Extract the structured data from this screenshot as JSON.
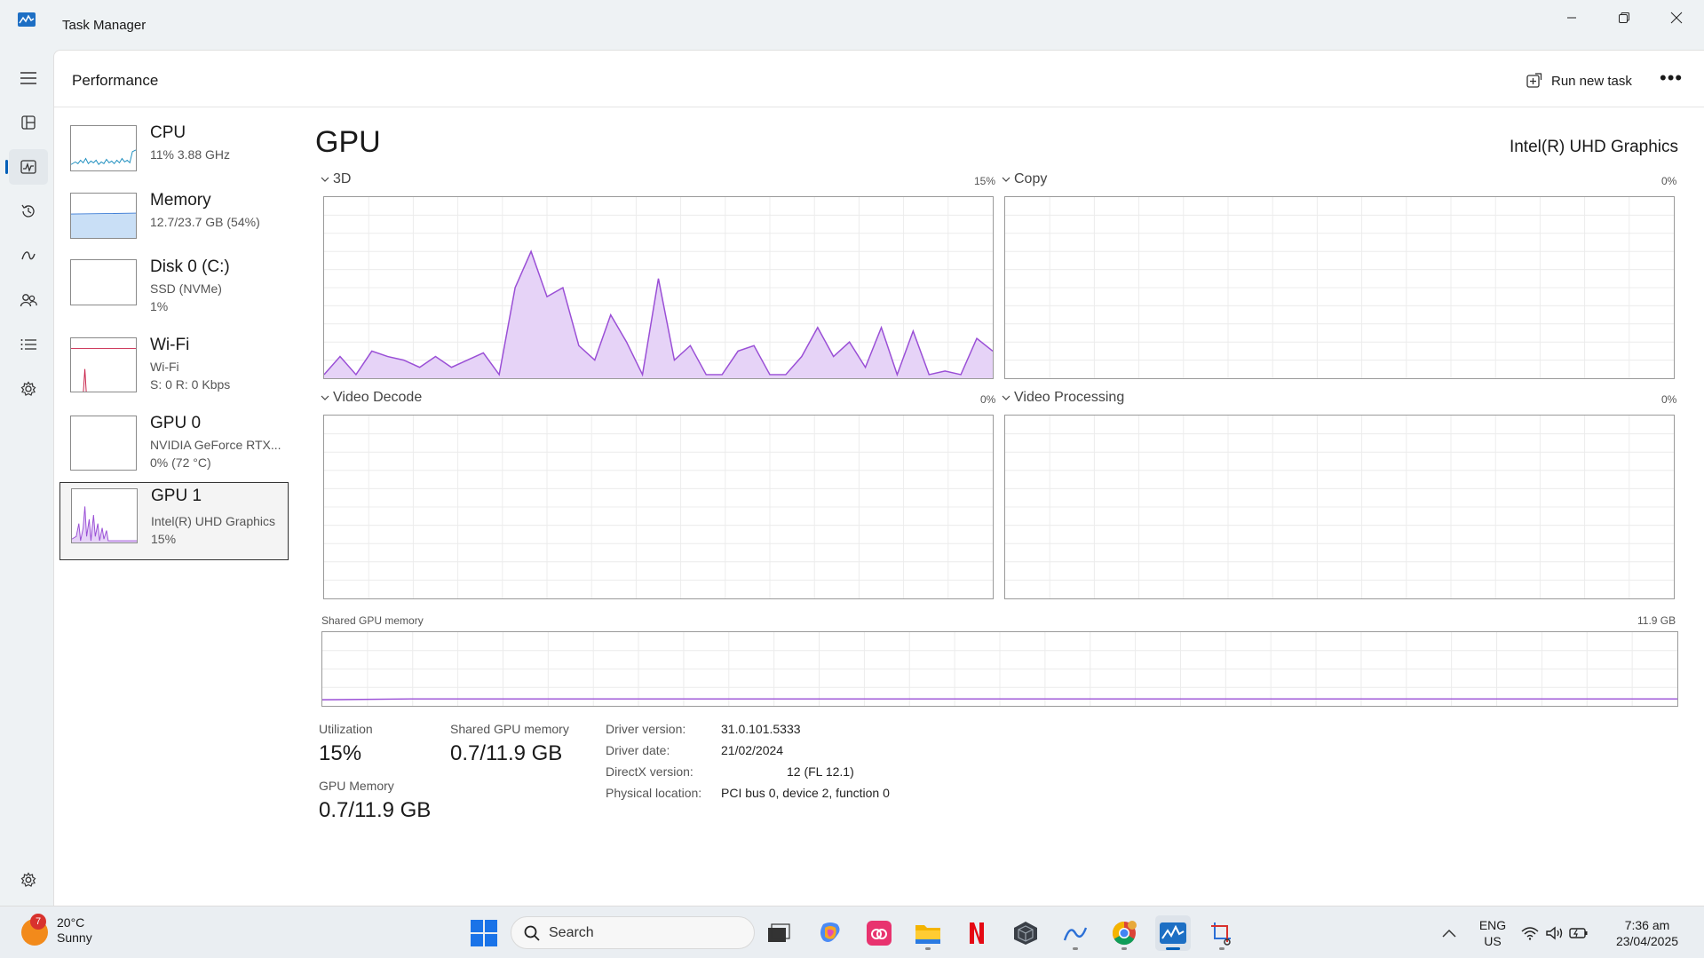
{
  "window": {
    "title": "Task Manager"
  },
  "header": {
    "page_title": "Performance",
    "run_new_task": "Run new task",
    "more": "•••"
  },
  "resources": [
    {
      "name": "CPU",
      "line1": "11%  3.88 GHz",
      "line2": ""
    },
    {
      "name": "Memory",
      "line1": "12.7/23.7 GB (54%)",
      "line2": ""
    },
    {
      "name": "Disk 0 (C:)",
      "line1": "SSD (NVMe)",
      "line2": "1%"
    },
    {
      "name": "Wi-Fi",
      "line1": "Wi-Fi",
      "line2": "S: 0  R: 0 Kbps"
    },
    {
      "name": "GPU 0",
      "line1": "NVIDIA GeForce RTX...",
      "line2": "0%  (72 °C)"
    },
    {
      "name": "GPU 1",
      "line1": "Intel(R) UHD Graphics",
      "line2": "15%"
    }
  ],
  "detail": {
    "title": "GPU",
    "device": "Intel(R) UHD Graphics",
    "engines": [
      {
        "label": "3D",
        "pct": "15%"
      },
      {
        "label": "Copy",
        "pct": "0%"
      },
      {
        "label": "Video Decode",
        "pct": "0%"
      },
      {
        "label": "Video Processing",
        "pct": "0%"
      }
    ],
    "shared_memory": {
      "label": "Shared GPU memory",
      "max": "11.9 GB"
    },
    "stats": {
      "utilization_label": "Utilization",
      "utilization_value": "15%",
      "shared_label": "Shared GPU memory",
      "shared_value": "0.7/11.9 GB",
      "gpu_memory_label": "GPU Memory",
      "gpu_memory_value": "0.7/11.9 GB"
    },
    "info": {
      "driver_version_label": "Driver version:",
      "driver_version": "31.0.101.5333",
      "driver_date_label": "Driver date:",
      "driver_date": "21/02/2024",
      "directx_label": "DirectX version:",
      "directx": "12 (FL 12.1)",
      "location_label": "Physical location:",
      "location": "PCI bus 0, device 2, function 0"
    }
  },
  "chart_data": {
    "type": "area",
    "title": "3D",
    "ylim": [
      0,
      100
    ],
    "series": [
      {
        "values": [
          2,
          12,
          2,
          15,
          12,
          10,
          6,
          12,
          6,
          10,
          14,
          2,
          50,
          70,
          45,
          50,
          18,
          10,
          35,
          20,
          2,
          55,
          10,
          18,
          2,
          2,
          15,
          18,
          2,
          2,
          12,
          28,
          12,
          20,
          6,
          28,
          2,
          26,
          2,
          4,
          2,
          22,
          15
        ]
      }
    ]
  },
  "taskbar": {
    "weather_temp": "20°C",
    "weather_desc": "Sunny",
    "weather_badge": "7",
    "search": "Search",
    "lang1": "ENG",
    "lang2": "US",
    "time": "7:36 am",
    "date": "23/04/2025"
  },
  "colors": {
    "gpu": "#9a4fd6",
    "gpu_fill": "#e6d3f7",
    "cpu": "#1e8fbf",
    "wifi": "#c8224a"
  }
}
